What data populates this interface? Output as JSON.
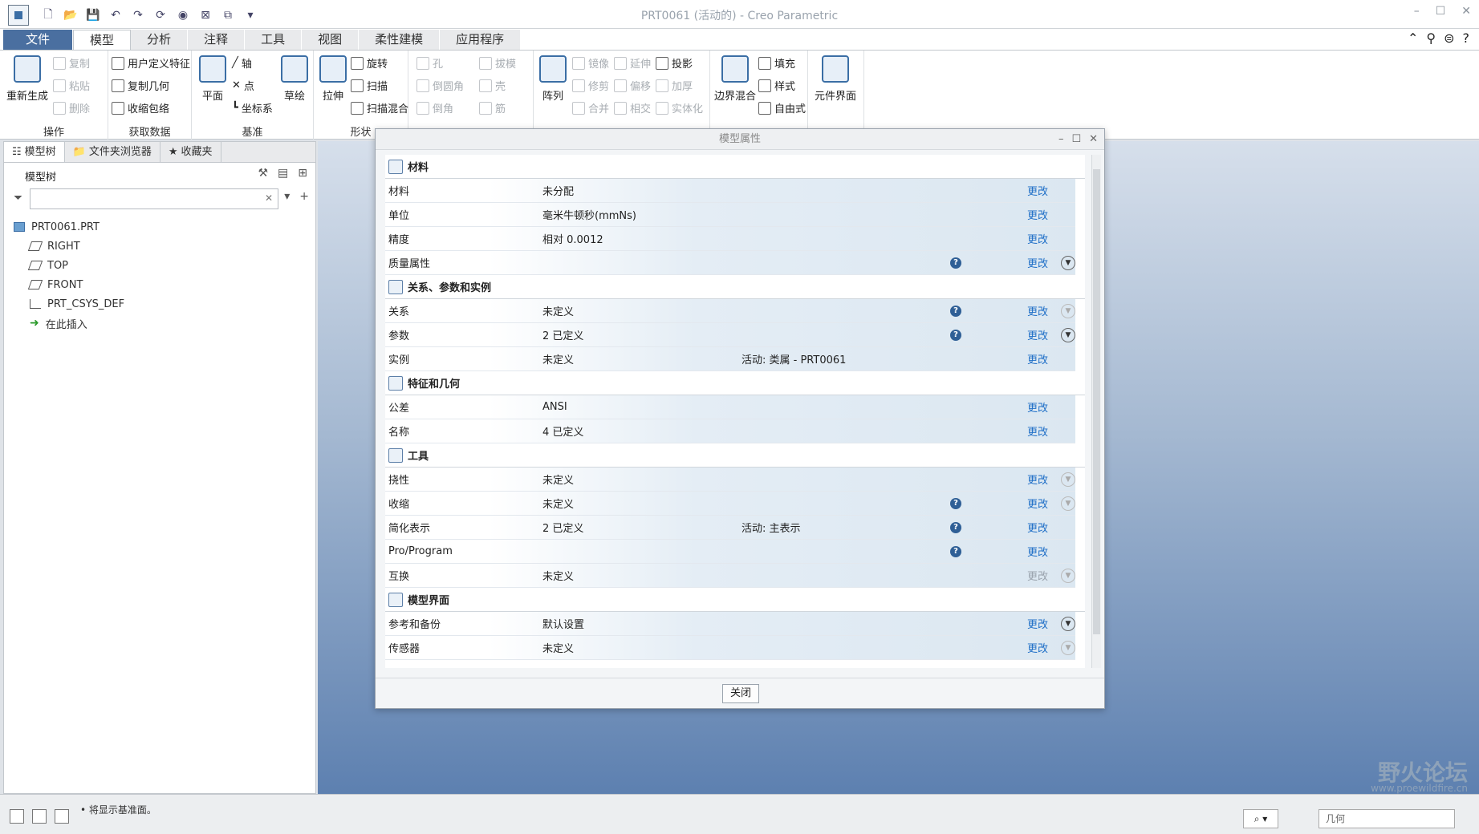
{
  "window": {
    "title": "PRT0061 (活动的) - Creo Parametric"
  },
  "ribbon_tabs": [
    "文件",
    "模型",
    "分析",
    "注释",
    "工具",
    "视图",
    "柔性建模",
    "应用程序"
  ],
  "ribbon": {
    "ops": {
      "regen": "重新生成",
      "copy": "复制",
      "paste": "粘贴",
      "delete": "删除",
      "label": "操作"
    },
    "get": {
      "udf": "用户定义特征",
      "copygeom": "复制几何",
      "shrink": "收缩包络",
      "label": "获取数据"
    },
    "datum": {
      "plane": "平面",
      "axis": "轴",
      "point": "点",
      "csys": "坐标系",
      "sketch": "草绘",
      "label": "基准"
    },
    "shape": {
      "extrude": "拉伸",
      "revolve": "旋转",
      "sweep": "扫描",
      "blend": "扫描混合",
      "label": "形状"
    },
    "eng": {
      "hole": "孔",
      "round": "倒圆角",
      "chamfer": "倒角",
      "draft": "拔模",
      "shell": "壳",
      "rib": "筋"
    },
    "edit": {
      "pattern": "阵列",
      "mirror": "镜像",
      "trim": "修剪",
      "merge": "合并",
      "extend": "延伸",
      "offset": "偏移",
      "intersect": "相交",
      "project": "投影",
      "thicken": "加厚",
      "solidify": "实体化"
    },
    "surf": {
      "boundary": "边界混合",
      "fill": "填充",
      "style": "样式",
      "freestyle": "自由式"
    },
    "interface": {
      "label": "元件界面"
    }
  },
  "panel": {
    "tabs": [
      "模型树",
      "文件夹浏览器",
      "收藏夹"
    ],
    "title": "模型树",
    "tree": [
      "PRT0061.PRT",
      "RIGHT",
      "TOP",
      "FRONT",
      "PRT_CSYS_DEF",
      "在此插入"
    ]
  },
  "dialog": {
    "title": "模型属性",
    "close": "关闭",
    "sections": [
      {
        "title": "材料",
        "rows": [
          {
            "name": "材料",
            "value": "未分配",
            "extra": "",
            "info": false,
            "change": "更改",
            "exp": ""
          },
          {
            "name": "单位",
            "value": "毫米牛顿秒(mmNs)",
            "extra": "",
            "info": false,
            "change": "更改",
            "exp": ""
          },
          {
            "name": "精度",
            "value": "相对 0.0012",
            "extra": "",
            "info": false,
            "change": "更改",
            "exp": ""
          },
          {
            "name": "质量属性",
            "value": "",
            "extra": "",
            "info": true,
            "change": "更改",
            "exp": "down"
          }
        ]
      },
      {
        "title": "关系、参数和实例",
        "rows": [
          {
            "name": "关系",
            "value": "未定义",
            "extra": "",
            "info": true,
            "change": "更改",
            "exp": "dim"
          },
          {
            "name": "参数",
            "value": "2 已定义",
            "extra": "",
            "info": true,
            "change": "更改",
            "exp": "down"
          },
          {
            "name": "实例",
            "value": "未定义",
            "extra": "活动: 类属 - PRT0061",
            "info": false,
            "change": "更改",
            "exp": ""
          }
        ]
      },
      {
        "title": "特征和几何",
        "rows": [
          {
            "name": "公差",
            "value": "ANSI",
            "extra": "",
            "info": false,
            "change": "更改",
            "exp": ""
          },
          {
            "name": "名称",
            "value": "4 已定义",
            "extra": "",
            "info": false,
            "change": "更改",
            "exp": ""
          }
        ]
      },
      {
        "title": "工具",
        "rows": [
          {
            "name": "挠性",
            "value": "未定义",
            "extra": "",
            "info": false,
            "change": "更改",
            "exp": "dim"
          },
          {
            "name": "收缩",
            "value": "未定义",
            "extra": "",
            "info": true,
            "change": "更改",
            "exp": "dim"
          },
          {
            "name": "简化表示",
            "value": "2 已定义",
            "extra": "活动: 主表示",
            "info": true,
            "change": "更改",
            "exp": ""
          },
          {
            "name": "Pro/Program",
            "value": "",
            "extra": "",
            "info": true,
            "change": "更改",
            "exp": ""
          },
          {
            "name": "互换",
            "value": "未定义",
            "extra": "",
            "info": false,
            "change": "更改",
            "exp": "dim",
            "disabled": true
          }
        ]
      },
      {
        "title": "模型界面",
        "rows": [
          {
            "name": "参考和备份",
            "value": "默认设置",
            "extra": "",
            "info": false,
            "change": "更改",
            "exp": "down"
          },
          {
            "name": "传感器",
            "value": "未定义",
            "extra": "",
            "info": false,
            "change": "更改",
            "exp": "dim"
          }
        ]
      }
    ]
  },
  "status": {
    "message": "• 将显示基准面。",
    "filter": "几何"
  },
  "watermark": {
    "text": "野火论坛",
    "url": "www.proewildfire.cn"
  }
}
